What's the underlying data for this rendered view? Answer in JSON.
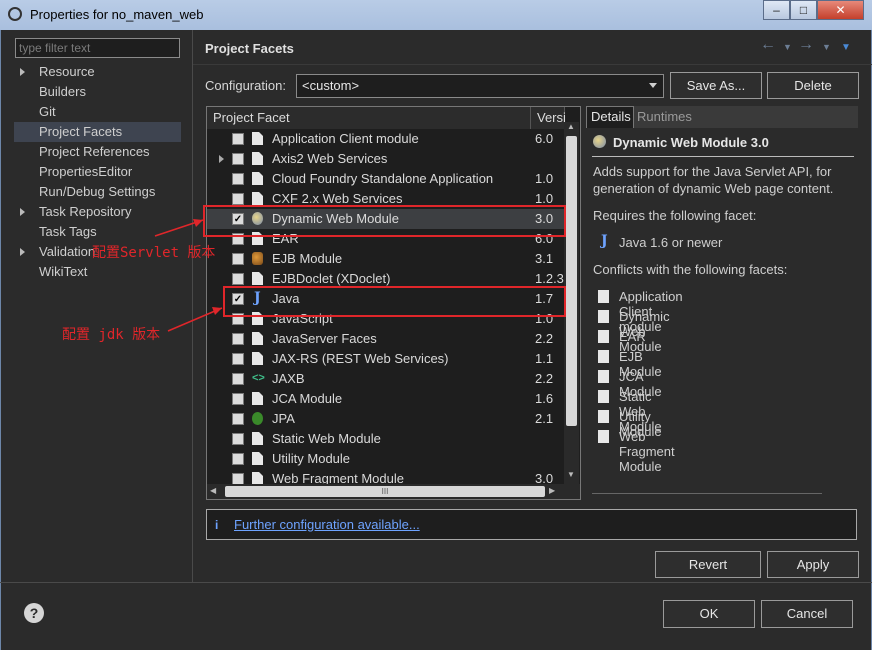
{
  "window": {
    "title": "Properties for no_maven_web",
    "controls": [
      "minimize",
      "maximize",
      "close"
    ]
  },
  "nav": {
    "filter_placeholder": "type filter text",
    "items": [
      {
        "label": "Resource",
        "expandable": true
      },
      {
        "label": "Builders",
        "expandable": false
      },
      {
        "label": "Git",
        "expandable": false
      },
      {
        "label": "Project Facets",
        "expandable": false,
        "selected": true
      },
      {
        "label": "Project References",
        "expandable": false
      },
      {
        "label": "PropertiesEditor",
        "expandable": false
      },
      {
        "label": "Run/Debug Settings",
        "expandable": false
      },
      {
        "label": "Task Repository",
        "expandable": true
      },
      {
        "label": "Task Tags",
        "expandable": false
      },
      {
        "label": "Validation",
        "expandable": true
      },
      {
        "label": "WikiText",
        "expandable": false
      }
    ]
  },
  "header": {
    "title": "Project Facets"
  },
  "config": {
    "label": "Configuration:",
    "value": "<custom>",
    "save_as_label": "Save As...",
    "delete_label": "Delete"
  },
  "facets": {
    "col_facet": "Project Facet",
    "col_version": "Versi",
    "rows": [
      {
        "name": "Application Client module",
        "version": "6.0",
        "checked": false,
        "icon": "doc-icon"
      },
      {
        "name": "Axis2 Web Services",
        "version": "",
        "checked": false,
        "icon": "doc-icon",
        "expandable": true
      },
      {
        "name": "Cloud Foundry Standalone Application",
        "version": "1.0",
        "checked": false,
        "icon": "doc-icon"
      },
      {
        "name": "CXF 2.x Web Services",
        "version": "1.0",
        "checked": false,
        "icon": "doc-icon"
      },
      {
        "name": "Dynamic Web Module",
        "version": "3.0",
        "checked": true,
        "icon": "globe-icon",
        "selected": true
      },
      {
        "name": "EAR",
        "version": "6.0",
        "checked": false,
        "icon": "doc-icon"
      },
      {
        "name": "EJB Module",
        "version": "3.1",
        "checked": false,
        "icon": "bean-icon"
      },
      {
        "name": "EJBDoclet (XDoclet)",
        "version": "1.2.3",
        "checked": false,
        "icon": "doc-icon"
      },
      {
        "name": "Java",
        "version": "1.7",
        "checked": true,
        "icon": "java-icon"
      },
      {
        "name": "JavaScript",
        "version": "1.0",
        "checked": false,
        "icon": "doc-icon"
      },
      {
        "name": "JavaServer Faces",
        "version": "2.2",
        "checked": false,
        "icon": "doc-icon"
      },
      {
        "name": "JAX-RS (REST Web Services)",
        "version": "1.1",
        "checked": false,
        "icon": "doc-icon"
      },
      {
        "name": "JAXB",
        "version": "2.2",
        "checked": false,
        "icon": "code-icon"
      },
      {
        "name": "JCA Module",
        "version": "1.6",
        "checked": false,
        "icon": "doc-icon"
      },
      {
        "name": "JPA",
        "version": "2.1",
        "checked": false,
        "icon": "jpa-icon"
      },
      {
        "name": "Static Web Module",
        "version": "",
        "checked": false,
        "icon": "doc-icon"
      },
      {
        "name": "Utility Module",
        "version": "",
        "checked": false,
        "icon": "doc-icon"
      },
      {
        "name": "Web Fragment Module",
        "version": "3.0",
        "checked": false,
        "icon": "doc-icon"
      }
    ],
    "hscroll_grip": "III"
  },
  "details": {
    "tab_details": "Details",
    "tab_runtimes": "Runtimes",
    "title": "Dynamic Web Module 3.0",
    "description_line1": "Adds support for the Java Servlet API, for",
    "description_line2": "generation of dynamic Web page content.",
    "requires_label": "Requires the following facet:",
    "requires": [
      "Java 1.6 or newer"
    ],
    "conflicts_label": "Conflicts with the following facets:",
    "conflicts": [
      "Application Client module",
      "Dynamic Web Module",
      "EAR",
      "EJB Module",
      "JCA Module",
      "Static Web Module",
      "Utility Module",
      "Web Fragment Module"
    ]
  },
  "further_link": "Further configuration available...",
  "buttons": {
    "revert": "Revert",
    "apply": "Apply",
    "ok": "OK",
    "cancel": "Cancel"
  },
  "annotations": {
    "servlet": "配置Servlet 版本",
    "jdk": "配置 jdk 版本",
    "color": "#e0262a"
  }
}
